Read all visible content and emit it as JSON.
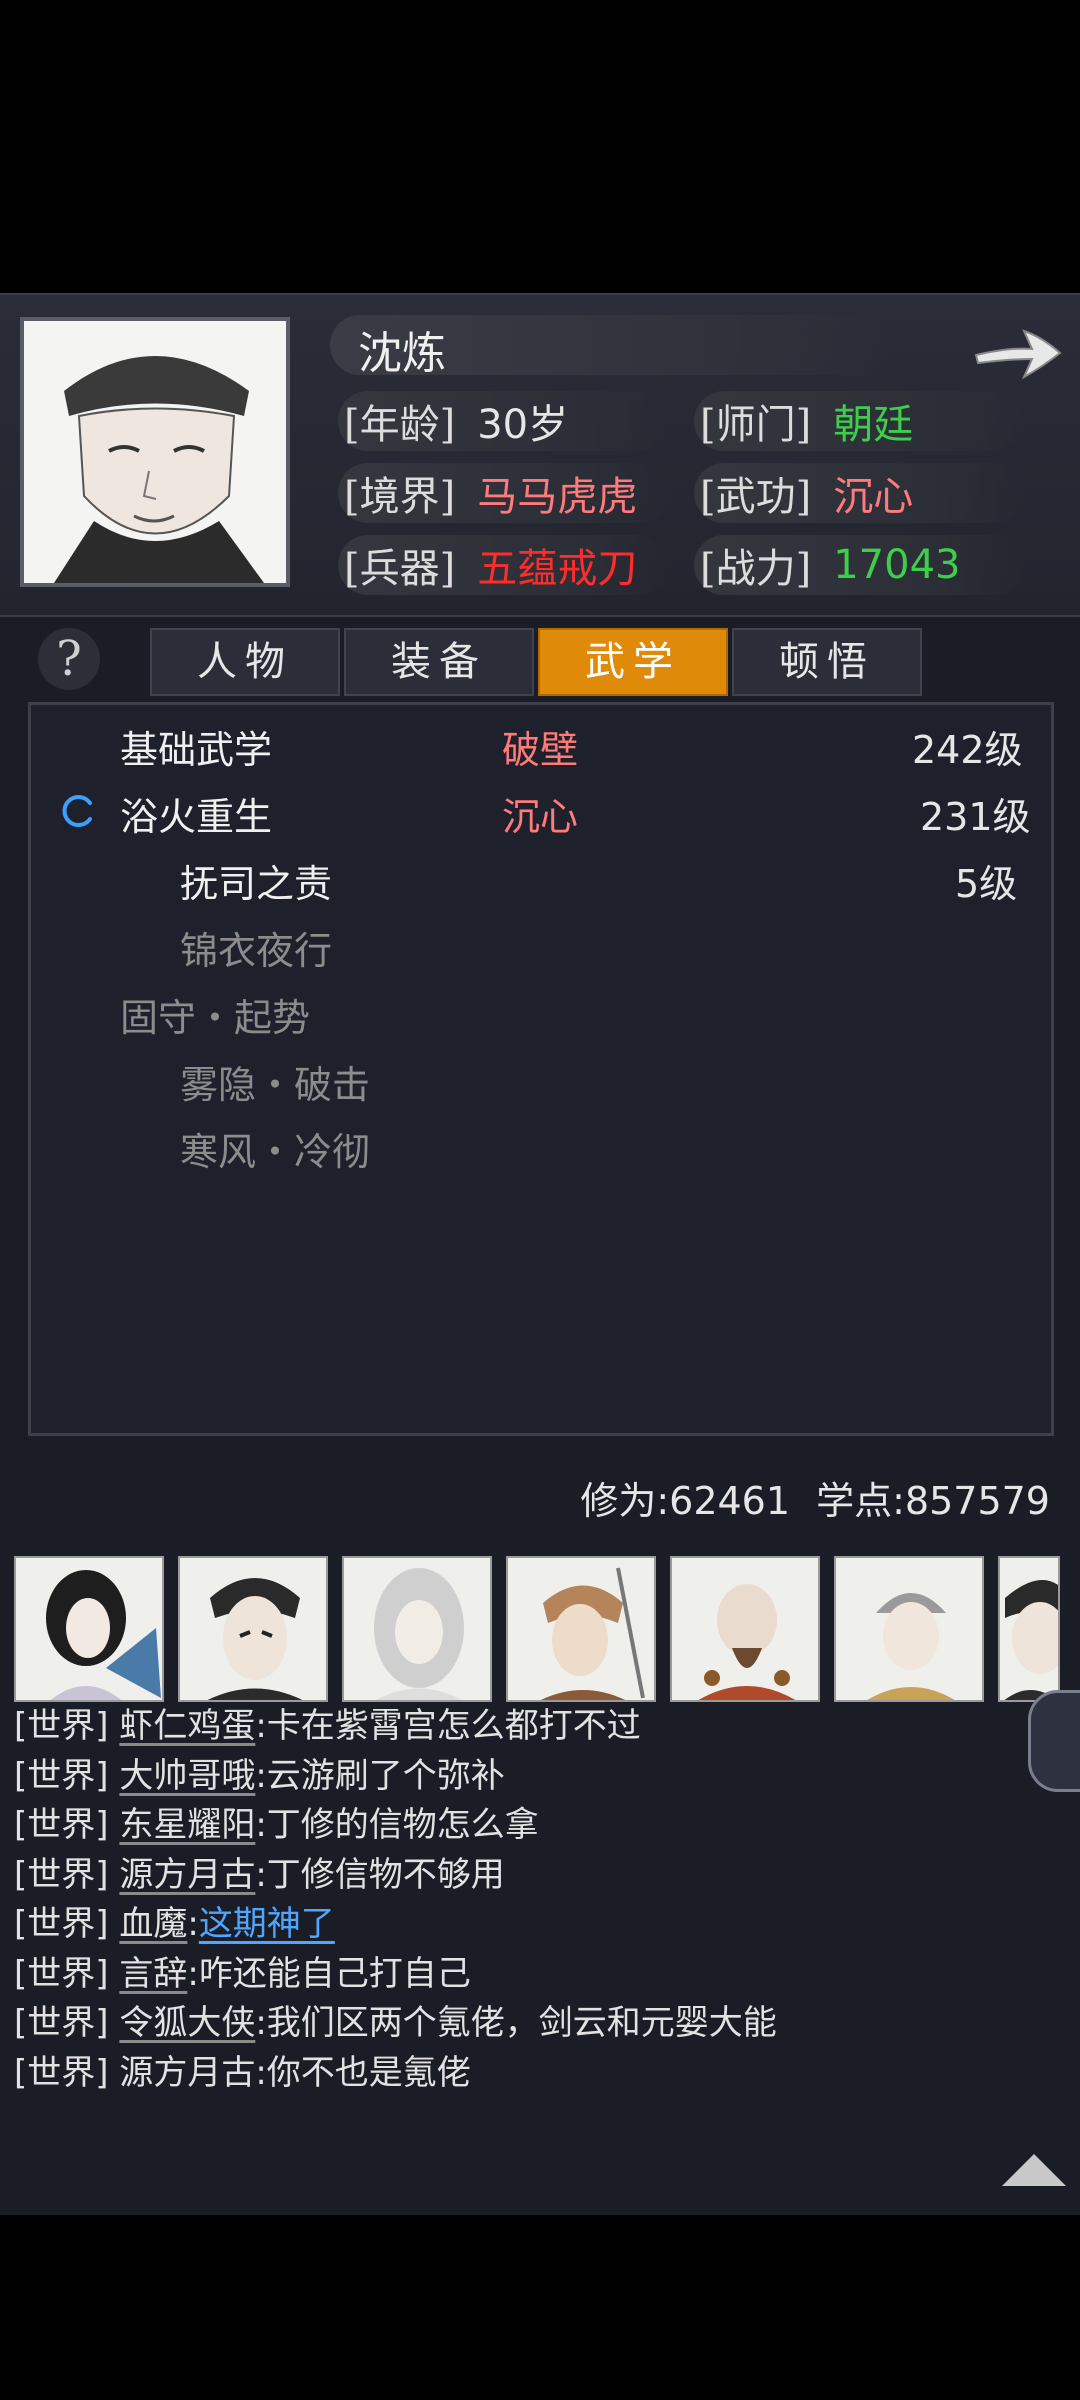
{
  "profile": {
    "name": "沈炼",
    "age_label": "[年龄]",
    "age_value": "30岁",
    "sect_label": "[师门]",
    "sect_value": "朝廷",
    "realm_label": "[境界]",
    "realm_value": "马马虎虎",
    "skill_label": "[武功]",
    "skill_value": "沉心",
    "weapon_label": "[兵器]",
    "weapon_value": "五蕴戒刀",
    "power_label": "[战力]",
    "power_value": "17043"
  },
  "colors": {
    "green": "#3ecf4a",
    "pink": "#ff7a7a",
    "red": "#ff2c2c",
    "orange_tab": "#e08a0a",
    "link_blue": "#4fa6ff"
  },
  "help_icon": "?",
  "tabs": [
    {
      "label": "人物",
      "active": false
    },
    {
      "label": "装备",
      "active": false
    },
    {
      "label": "武学",
      "active": true
    },
    {
      "label": "顿悟",
      "active": false
    }
  ],
  "martial": [
    {
      "name": "基础武学",
      "tag": "破壁",
      "level": "242级"
    },
    {
      "name": "浴火重生",
      "tag": "沉心",
      "level": "231级"
    },
    {
      "name": "抚司之责",
      "tag": "",
      "level": "5级"
    },
    {
      "name": "锦衣夜行",
      "tag": "",
      "level": ""
    },
    {
      "name": "固守・起势",
      "tag": "",
      "level": ""
    },
    {
      "name": "雾隐・破击",
      "tag": "",
      "level": ""
    },
    {
      "name": "寒风・冷彻",
      "tag": "",
      "level": ""
    }
  ],
  "footer_stats": {
    "cultivation": "修为:62461",
    "points": "学点:857579"
  },
  "chat": [
    {
      "channel": "[世界]",
      "user": "虾仁鸡蛋",
      "message": ":卡在紫霄宫怎么都打不过",
      "link": false
    },
    {
      "channel": "[世界]",
      "user": "大帅哥哦",
      "message": ":云游刷了个弥补",
      "link": false
    },
    {
      "channel": "[世界]",
      "user": "东星耀阳",
      "message": ":丁修的信物怎么拿",
      "link": false
    },
    {
      "channel": "[世界]",
      "user": "源方月古",
      "message": ":丁修信物不够用",
      "link": false
    },
    {
      "channel": "[世界]",
      "user": "血魔",
      "message": "这期神了",
      "link": true
    },
    {
      "channel": "[世界]",
      "user": "言辞",
      "message": ":咋还能自己打自己",
      "link": false
    },
    {
      "channel": "[世界]",
      "user": "令狐大侠",
      "message": ":我们区两个氪佬，剑云和元婴大能",
      "link": false
    },
    {
      "channel": "[世界]",
      "user": "源方月古",
      "message": ":你不也是氪佬",
      "link": false
    }
  ]
}
